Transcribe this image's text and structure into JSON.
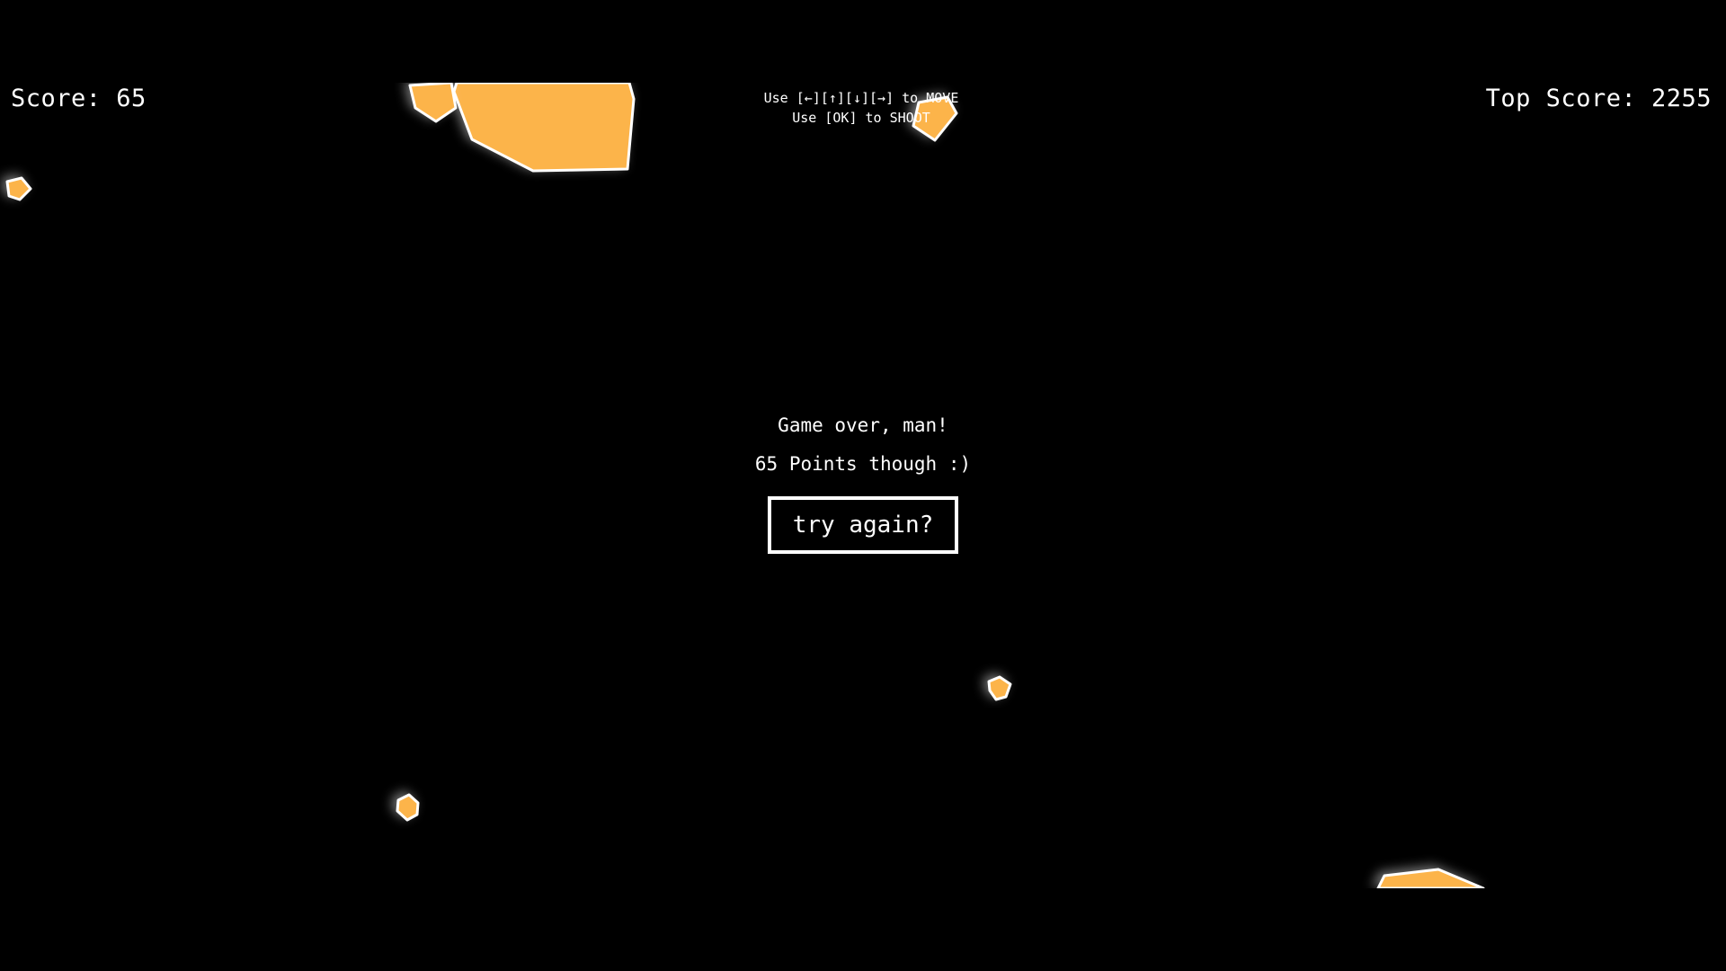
{
  "hud": {
    "score_label": "Score: 65",
    "top_score_label": "Top Score: 2255"
  },
  "instructions": {
    "move": "Use [←][↑][↓][→] to MOVE",
    "shoot": "Use [OK] to SHOOT"
  },
  "game_over": {
    "title": "Game over, man!",
    "points": "65 Points though :)",
    "retry_label": "try again?"
  },
  "colors": {
    "background": "#000000",
    "asteroid_fill": "#fcb44a",
    "asteroid_outline": "#ffffff",
    "text": "#ffffff"
  },
  "asteroids": [
    {
      "size": "large"
    },
    {
      "size": "small"
    },
    {
      "size": "small"
    },
    {
      "size": "small"
    },
    {
      "size": "small"
    },
    {
      "size": "small"
    },
    {
      "size": "medium"
    }
  ]
}
